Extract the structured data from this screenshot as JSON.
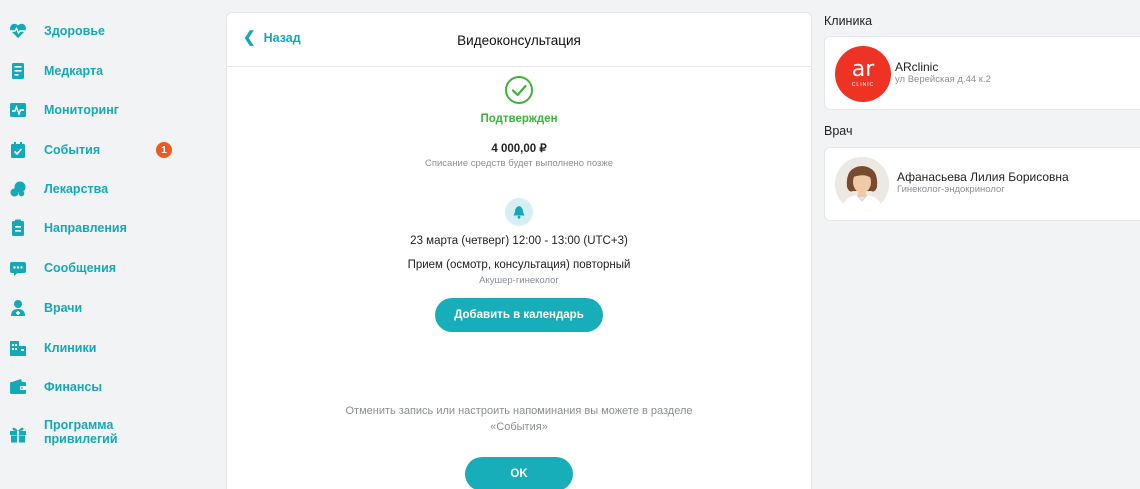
{
  "sidebar": {
    "items": [
      {
        "label": "Здоровье",
        "icon": "heart-icon"
      },
      {
        "label": "Медкарта",
        "icon": "medical-card-icon"
      },
      {
        "label": "Мониторинг",
        "icon": "monitoring-icon"
      },
      {
        "label": "События",
        "icon": "calendar-icon",
        "badge": "1"
      },
      {
        "label": "Лекарства",
        "icon": "pills-icon"
      },
      {
        "label": "Направления",
        "icon": "referral-icon"
      },
      {
        "label": "Сообщения",
        "icon": "messages-icon"
      },
      {
        "label": "Врачи",
        "icon": "doctor-icon"
      },
      {
        "label": "Клиники",
        "icon": "clinic-icon"
      },
      {
        "label": "Финансы",
        "icon": "wallet-icon"
      },
      {
        "label": "Программа привилегий",
        "icon": "gift-icon"
      }
    ]
  },
  "main": {
    "back_label": "Назад",
    "title": "Видеоконсультация",
    "status": "Подтвержден",
    "price": "4 000,00 ₽",
    "price_note": "Списание средств будет выполнено позже",
    "datetime": "23 марта (четверг) 12:00 - 13:00 (UTC+3)",
    "service": "Прием (осмотр, консультация) повторный",
    "specialty": "Акушер-гинеколог",
    "calendar_button": "Добавить в календарь",
    "cancel_info_line1": "Отменить запись или настроить напоминания вы можете в разделе",
    "cancel_info_line2": "«События»",
    "ok_button": "OK"
  },
  "clinic": {
    "section_title": "Клиника",
    "logo_text": "ar",
    "logo_sub": "CLINIC",
    "name": "ARclinic",
    "address": "ул Верейская д.44 к.2"
  },
  "doctor": {
    "section_title": "Врач",
    "name": "Афанасьева Лилия Борисовна",
    "specialty": "Гинеколог-эндокринолог"
  },
  "colors": {
    "accent": "#14a9b8",
    "button": "#18aeb9",
    "success": "#3cb43c",
    "badge": "#ea5a24",
    "clinic_logo": "#ee3325"
  }
}
